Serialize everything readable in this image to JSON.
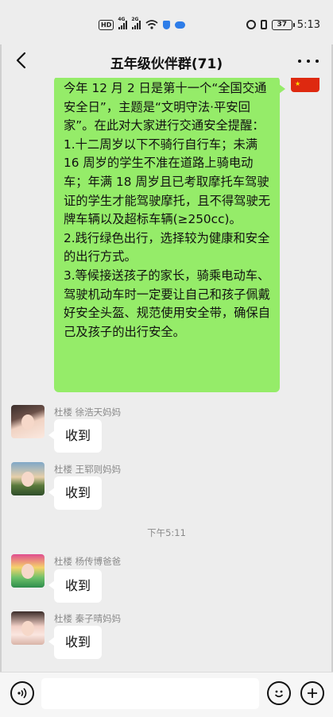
{
  "status_bar": {
    "hd_badge": "HD",
    "signal1_label": "4G",
    "signal2_label": "2G",
    "battery": "37",
    "time": "5:13"
  },
  "header": {
    "title": "五年级伙伴群(71)"
  },
  "messages": [
    {
      "type": "outgoing",
      "text": "今年 12 月 2 日是第十一个“全国交通安全日”，主题是“文明守法·平安回家”。在此对大家进行交通安全提醒：\n1.十二周岁以下不骑行自行车；未满 16 周岁的学生不准在道路上骑电动车；年满 18 周岁且已考取摩托车驾驶证的学生才能驾驶摩托，且不得驾驶无牌车辆以及超标车辆(≥250cc)。\n2.践行绿色出行，选择较为健康和安全的出行方式。\n3.等候接送孩子的家长，骑乘电动车、驾驶机动车时一定要让自己和孩子佩戴好安全头盔、规范使用安全带，确保自己及孩子的出行安全。"
    },
    {
      "type": "incoming",
      "sender": "杜楼 徐浩天妈妈",
      "text": "收到"
    },
    {
      "type": "incoming",
      "sender": "杜楼 王郓则妈妈",
      "text": "收到"
    },
    {
      "type": "time",
      "text": "下午5:11"
    },
    {
      "type": "incoming",
      "sender": "杜楼 杨传博爸爸",
      "text": "收到"
    },
    {
      "type": "incoming",
      "sender": "杜楼 秦子晴妈妈",
      "text": "收到"
    }
  ],
  "icons": {
    "back": "back-arrow-icon",
    "more": "more-dots-icon",
    "voice": "voice-icon",
    "emoji": "emoji-icon",
    "plus": "plus-icon"
  },
  "colors": {
    "outgoing_bubble": "#95ec69",
    "incoming_bubble": "#ffffff",
    "chat_background": "#ededed"
  }
}
